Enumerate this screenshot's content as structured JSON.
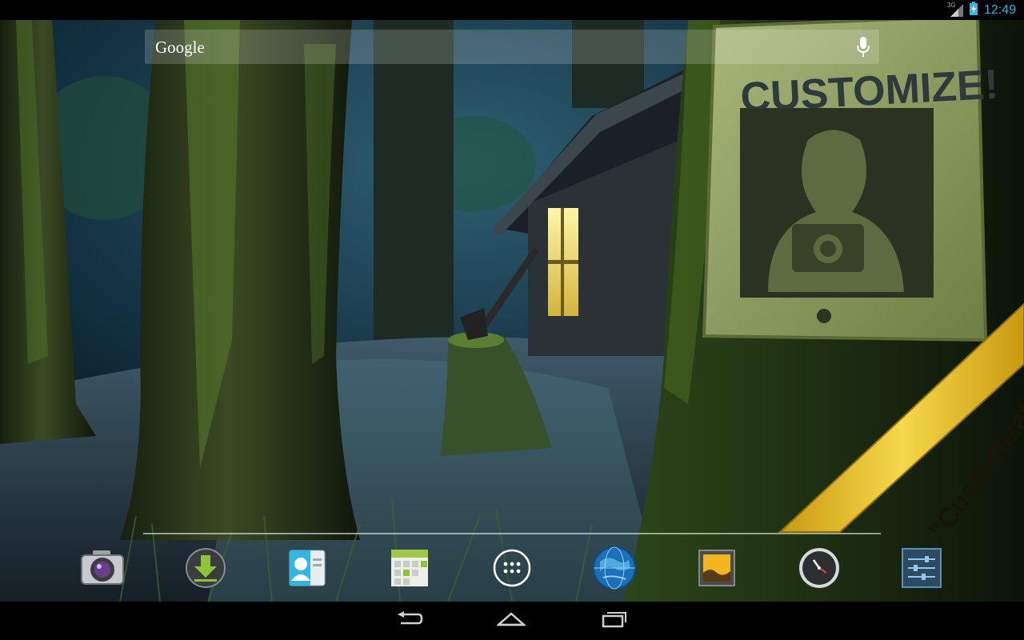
{
  "status_bar": {
    "network": "3G",
    "time": "12:49"
  },
  "search_bar": {
    "label": "Google"
  },
  "wallpaper": {
    "sign_title": "CUSTOMIZE!",
    "ribbon_text": "\"Customization Pack\""
  },
  "dock": {
    "apps": [
      {
        "name": "Camera",
        "icon": "camera-icon"
      },
      {
        "name": "Downloads",
        "icon": "download-icon"
      },
      {
        "name": "Contacts",
        "icon": "contacts-icon"
      },
      {
        "name": "Calendar",
        "icon": "calendar-icon"
      },
      {
        "name": "All apps",
        "icon": "apps-grid-icon"
      },
      {
        "name": "Browser",
        "icon": "globe-icon"
      },
      {
        "name": "Gallery",
        "icon": "gallery-icon"
      },
      {
        "name": "Clock",
        "icon": "clock-icon"
      },
      {
        "name": "Settings",
        "icon": "settings-icon"
      }
    ]
  },
  "nav_bar": {
    "buttons": [
      "back-icon",
      "home-icon",
      "recents-icon"
    ]
  },
  "colors": {
    "accent": "#33b5e5",
    "ribbon": "#e6c21e"
  }
}
